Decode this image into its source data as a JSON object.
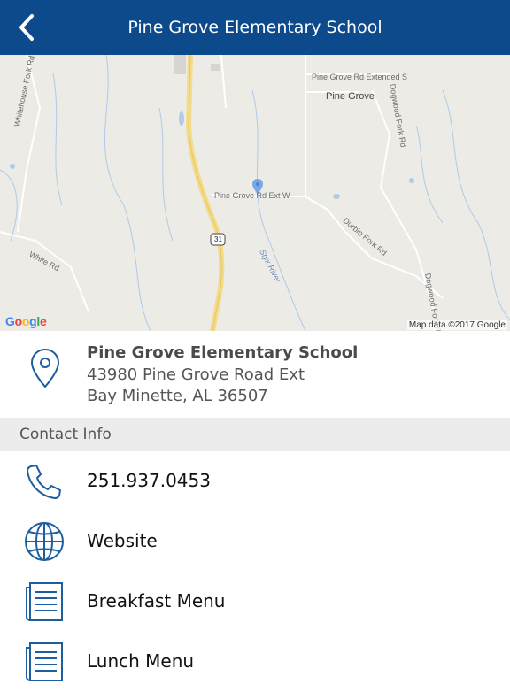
{
  "header": {
    "title": "Pine Grove Elementary School",
    "back_icon": "chevron-left-icon"
  },
  "map": {
    "labels": {
      "whitehouse": "Whitehouse Fork Rd",
      "extended": "Pine Grove Rd Extended S",
      "town": "Pine Grove",
      "dogwood1": "Dogwood Fork Rd",
      "extw": "Pine Grove Rd Ext W",
      "durbin": "Durbin Fork Rd",
      "white": "White Rd",
      "styx": "Styx River",
      "dogwood2": "Dogwood Fork Rd",
      "shield": "31"
    },
    "google": "Google",
    "attribution": "Map data ©2017 Google"
  },
  "address": {
    "name": "Pine Grove Elementary School",
    "street": "43980 Pine Grove Road Ext",
    "city": "Bay Minette, AL 36507"
  },
  "contact": {
    "section_title": "Contact Info",
    "items": [
      {
        "icon": "phone-icon",
        "label": "251.937.0453"
      },
      {
        "icon": "globe-icon",
        "label": "Website"
      },
      {
        "icon": "document-icon",
        "label": "Breakfast Menu"
      },
      {
        "icon": "document-icon",
        "label": "Lunch Menu"
      }
    ]
  },
  "colors": {
    "header": "#0d4a8c",
    "icon": "#1d5f9e",
    "section": "#ececec"
  }
}
